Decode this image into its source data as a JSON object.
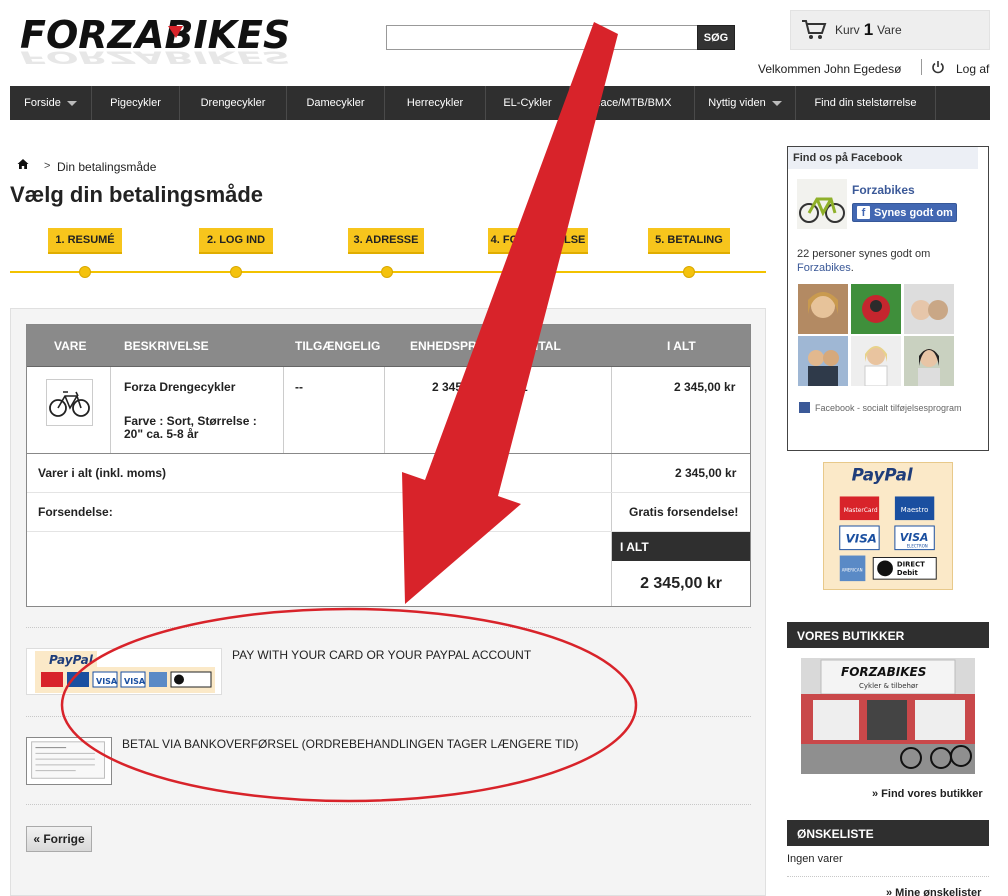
{
  "header": {
    "logo_text": "FORZABIKES",
    "search": {
      "value": "",
      "placeholder": "",
      "button_label": "SØG"
    },
    "cart": {
      "label_before": "Kurv",
      "count": "1",
      "label_after": "Vare"
    },
    "welcome": "Velkommen John Egedesø",
    "logout": "Log af"
  },
  "nav": {
    "items": [
      {
        "label": "Forside",
        "dropdown": true
      },
      {
        "label": "Pigecykler",
        "dropdown": false
      },
      {
        "label": "Drengecykler",
        "dropdown": false
      },
      {
        "label": "Damecykler",
        "dropdown": false
      },
      {
        "label": "Herrecykler",
        "dropdown": false
      },
      {
        "label": "EL-Cykler",
        "dropdown": false
      },
      {
        "label": "Race/MTB/BMX",
        "dropdown": false
      },
      {
        "label": "Nyttig viden",
        "dropdown": true
      },
      {
        "label": "Find din stelstørrelse",
        "dropdown": false
      }
    ]
  },
  "breadcrumb": {
    "separator": ">",
    "current": "Din betalingsmåde"
  },
  "page_title": "Vælg din betalingsmåde",
  "steps": [
    "1. RESUMÉ",
    "2. LOG IND",
    "3. ADRESSE",
    "4. FORSENDELSE",
    "5. BETALING"
  ],
  "cart_table": {
    "headers": [
      "VARE",
      "BESKRIVELSE",
      "TILGÆNGELIG",
      "ENHEDSPRIS",
      "ANTAL",
      "I ALT"
    ],
    "item": {
      "name": "Forza Drengecykler",
      "attr_line1": "Farve : Sort, Størrelse :",
      "attr_line2": "20\" ca. 5-8 år",
      "available": "--",
      "unit_price": "2 345,00 kr",
      "quantity": "1",
      "total": "2 345,00 kr"
    },
    "subtotal_label": "Varer i alt (inkl. moms)",
    "subtotal_value": "2 345,00 kr",
    "shipping_label": "Forsendelse:",
    "shipping_value": "Gratis forsendelse!",
    "grand_total_label": "I ALT",
    "grand_total_value": "2 345,00 kr"
  },
  "payment_options": {
    "paypal_label": "PAY WITH YOUR CARD OR YOUR PAYPAL ACCOUNT",
    "paypal_logo": "PayPal",
    "bank_label": "BETAL VIA BANKOVERFØRSEL (ORDREBEHANDLINGEN TAGER LÆNGERE TID)"
  },
  "prev_button": "« Forrige",
  "sidebar": {
    "facebook": {
      "title": "Find os på Facebook",
      "page_name": "Forzabikes",
      "like_label": "Synes godt om",
      "count_text": "22 personer synes godt om",
      "count_link": "Forzabikes",
      "footer": "Facebook - socialt tilføjelsesprogram"
    },
    "paypal_logo": "PayPal",
    "card_brands": [
      "MasterCard",
      "Maestro",
      "VISA",
      "VISA ELECTRON",
      "AMERICAN EXPRESS",
      "DIRECT Debit"
    ],
    "shops_title": "VORES BUTIKKER",
    "shop_sign": "FORZABIKES",
    "shop_sign_sub": "Cykler & tilbehør",
    "shops_link": "» Find vores butikker",
    "wishlist_title": "ØNSKELISTE",
    "wishlist_empty": "Ingen varer",
    "wishlist_link": "» Mine ønskelister"
  },
  "colors": {
    "nav_bg": "#2f2f2f",
    "step_yellow": "#f7c51c",
    "facebook_blue": "#3b5998",
    "annotation_red": "#d8232a"
  }
}
